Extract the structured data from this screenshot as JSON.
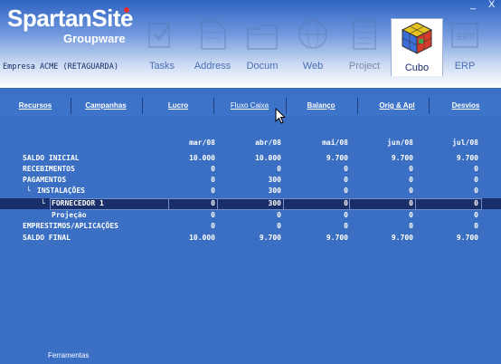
{
  "header": {
    "logo": "SpartanSite",
    "subtitle": "Groupware",
    "company": "Empresa ACME (RETAGUARDA)",
    "window_controls": {
      "minimize": "_",
      "close": "X"
    },
    "modules": [
      {
        "label": "Tasks",
        "icon": "tasks-icon"
      },
      {
        "label": "Address",
        "icon": "address-book-icon"
      },
      {
        "label": "Docum",
        "icon": "folder-icon"
      },
      {
        "label": "Web",
        "icon": "globe-icon"
      },
      {
        "label": "Project",
        "icon": "project-icon"
      },
      {
        "label": "Cubo",
        "icon": "rubik-cube-icon",
        "active": true
      },
      {
        "label": "ERP",
        "icon": "erp-icon"
      }
    ]
  },
  "tabs": [
    {
      "label": "Recursos"
    },
    {
      "label": "Campanhas"
    },
    {
      "label": "Lucro"
    },
    {
      "label": "Fluxo Caixa",
      "active": true
    },
    {
      "label": "Balanço"
    },
    {
      "label": "Orig & Apl"
    },
    {
      "label": "Desvios"
    }
  ],
  "table": {
    "columns": [
      "mar/08",
      "abr/08",
      "mai/08",
      "jun/08",
      "jul/08"
    ],
    "rows": [
      {
        "label": "SALDO INICIAL",
        "values": [
          "10.000",
          "10.000",
          "9.700",
          "9.700",
          "9.700"
        ]
      },
      {
        "label": "RECEBIMENTOS",
        "values": [
          "0",
          "0",
          "0",
          "0",
          "0"
        ]
      },
      {
        "label": "PAGAMENTOS",
        "values": [
          "0",
          "300",
          "0",
          "0",
          "0"
        ]
      },
      {
        "label": "INSTALAÇÕES",
        "values": [
          "0",
          "300",
          "0",
          "0",
          "0"
        ]
      },
      {
        "label": "FORNECEDOR 1",
        "values": [
          "0",
          "300",
          "0",
          "0",
          "0"
        ]
      },
      {
        "label": "Projeção",
        "values": [
          "0",
          "0",
          "0",
          "0",
          "0"
        ]
      },
      {
        "label": "EMPRESTIMOS/APLICAÇÕES",
        "values": [
          "0",
          "0",
          "0",
          "0",
          "0"
        ]
      },
      {
        "label": "SALDO FINAL",
        "values": [
          "10.000",
          "9.700",
          "9.700",
          "9.700",
          "9.700"
        ]
      }
    ]
  },
  "footer": {
    "label": "Ferramentas"
  },
  "colors": {
    "background": "#3a6fc4",
    "selected_row": "#1a2f6a",
    "text": "#ffffff"
  }
}
